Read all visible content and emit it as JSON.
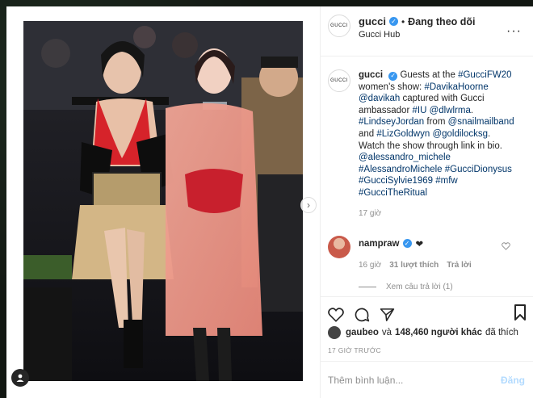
{
  "post": {
    "username": "gucci",
    "follow_status": "Đang theo dõi",
    "location": "Gucci Hub",
    "avatar_text": "GUCCI",
    "more_icon": "more-horizontal-icon"
  },
  "caption": {
    "author": "gucci",
    "segments": [
      {
        "t": "Guests at the ",
        "link": false
      },
      {
        "t": "#GucciFW20",
        "link": true
      },
      {
        "t": " women's show: ",
        "link": false
      },
      {
        "t": "#DavikaHoorne",
        "link": true
      },
      {
        "t": " ",
        "link": false
      },
      {
        "t": "@davikah",
        "link": true
      },
      {
        "t": " captured with Gucci ambassador ",
        "link": false
      },
      {
        "t": "#IU",
        "link": true
      },
      {
        "t": " ",
        "link": false
      },
      {
        "t": "@dlwlrma",
        "link": true
      },
      {
        "t": ". ",
        "link": false
      },
      {
        "t": "#LindseyJordan",
        "link": true
      },
      {
        "t": " from ",
        "link": false
      },
      {
        "t": "@snailmailband",
        "link": true
      },
      {
        "t": " and ",
        "link": false
      },
      {
        "t": "#LizGoldwyn",
        "link": true
      },
      {
        "t": " ",
        "link": false
      },
      {
        "t": "@goldilocksg",
        "link": true
      },
      {
        "t": ". Watch the show through link in bio. ",
        "link": false
      },
      {
        "t": "@alessandro_michele",
        "link": true
      },
      {
        "t": " ",
        "link": false
      },
      {
        "t": "#AlessandroMichele",
        "link": true
      },
      {
        "t": " ",
        "link": false
      },
      {
        "t": "#GucciDionysus",
        "link": true
      },
      {
        "t": " ",
        "link": false
      },
      {
        "t": "#GucciSylvie1969",
        "link": true
      },
      {
        "t": " ",
        "link": false
      },
      {
        "t": "#mfw",
        "link": true
      },
      {
        "t": " ",
        "link": false
      },
      {
        "t": "#GucciTheRitual",
        "link": true
      }
    ],
    "age": "17 giờ"
  },
  "comment": {
    "author": "nampraw",
    "text": "❤",
    "age": "16 giờ",
    "likes": "31 lượt thích",
    "reply": "Trả lời",
    "view_replies": "Xem câu trả lời (1)"
  },
  "likes": {
    "user": "gaubeo",
    "connector": "và",
    "others": "148,460 người khác",
    "suffix": "đã thích"
  },
  "timestamp": "17 GIỜ TRƯỚC",
  "add_comment": {
    "placeholder": "Thêm bình luận...",
    "post_label": "Đăng"
  },
  "colors": {
    "link": "#003569",
    "verified": "#3897f0",
    "post_disabled": "#b3dbff",
    "backdrop": "#121712"
  }
}
